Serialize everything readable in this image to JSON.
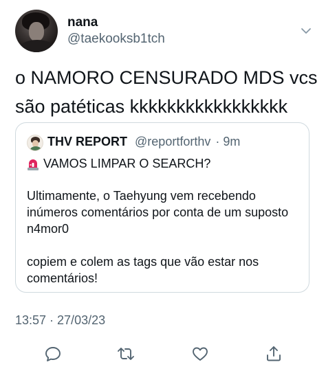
{
  "author": {
    "display_name": "nana",
    "handle": "@taekooksb1tch"
  },
  "tweet": {
    "text_line1": "o NAMORO CENSURADO MDS vcs",
    "text_line2": "são patéticas kkkkkkkkkkkkkkkkk"
  },
  "quoted_tweet": {
    "display_name": "THV REPORT",
    "handle": "@reportforthv",
    "age": "· 9m",
    "headline": "VAMOS LIMPAR O SEARCH?",
    "paragraph1": "Ultimamente, o Taehyung vem recebendo inúmeros comentários por conta de um suposto n4mor0",
    "paragraph2": "copiem e colem as tags que vão estar nos comentários!"
  },
  "timestamp": "13:57 · 27/03/23",
  "icons": {
    "more": "chevron-down-icon",
    "reply": "reply-icon",
    "retweet": "retweet-icon",
    "like": "heart-icon",
    "share": "share-icon",
    "siren": "siren-emoji-icon"
  },
  "colors": {
    "text": "#0f1419",
    "secondary": "#536471",
    "border": "#cfd9de"
  }
}
